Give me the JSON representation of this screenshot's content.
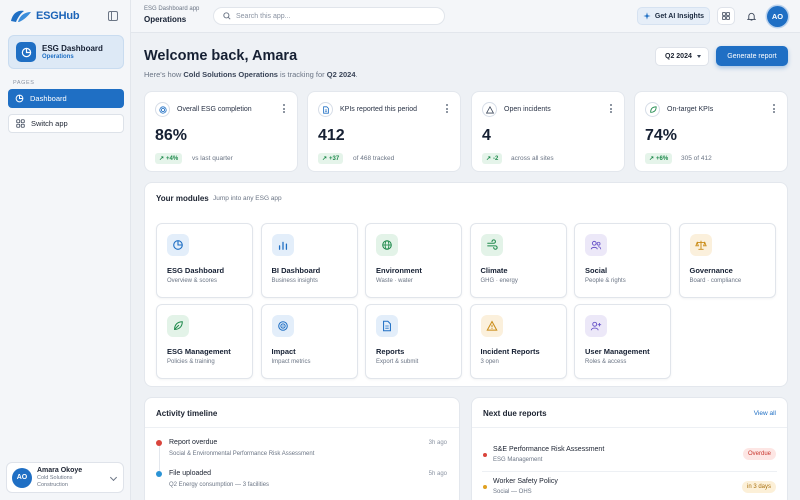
{
  "brand": {
    "name": "ESGHub"
  },
  "sidebar": {
    "app_card": {
      "title": "ESG Dashboard",
      "subtitle": "Operations"
    },
    "section_label": "PAGES",
    "items": [
      {
        "label": "Dashboard",
        "active": true,
        "icon": "pie-chart-icon"
      },
      {
        "label": "Switch app",
        "active": false,
        "icon": "grid-icon"
      }
    ],
    "user": {
      "initials": "AO",
      "name": "Amara Okoye",
      "org": "Cold Solutions Construction"
    }
  },
  "header": {
    "app_path": "ESG Dashboard app",
    "title": "Operations",
    "search_placeholder": "Search this app...",
    "ai_button": "Get AI Insights",
    "user_initials": "AO"
  },
  "main": {
    "welcome": "Welcome back, Amara",
    "subline": {
      "prefix": "Here's how ",
      "org": "Cold Solutions Operations",
      "middle": " is tracking for ",
      "period": "Q2 2024",
      "suffix": "."
    },
    "quarter_select": "Q2 2024",
    "generate_button": "Generate report",
    "kpis": [
      {
        "label": "Overall ESG completion",
        "value": "86%",
        "delta": "+4%",
        "note": "vs last quarter",
        "icon": "target-icon"
      },
      {
        "label": "KPIs reported this period",
        "value": "412",
        "delta": "+37",
        "note": "of 468 tracked",
        "icon": "document-icon"
      },
      {
        "label": "Open incidents",
        "value": "4",
        "delta": "-2",
        "note": "across all sites",
        "icon": "warning-icon"
      },
      {
        "label": "On-target KPIs",
        "value": "74%",
        "delta": "+6%",
        "note": "305 of 412",
        "icon": "leaf-icon"
      }
    ],
    "modules": {
      "title": "Your modules",
      "subtitle": "Jump into any ESG app",
      "items": [
        {
          "name": "ESG Dashboard",
          "desc": "Overview & scores",
          "icon": "pie-chart-icon",
          "color": "#1f6fc4",
          "bg": "#e3eefa"
        },
        {
          "name": "BI Dashboard",
          "desc": "Business insights",
          "icon": "bar-chart-icon",
          "color": "#1f6fc4",
          "bg": "#e3eefa"
        },
        {
          "name": "Environment",
          "desc": "Waste · water",
          "icon": "globe-icon",
          "color": "#1f8a4c",
          "bg": "#e3f3e8"
        },
        {
          "name": "Climate",
          "desc": "GHG · energy",
          "icon": "wind-icon",
          "color": "#1f8a4c",
          "bg": "#e3f3e8"
        },
        {
          "name": "Social",
          "desc": "People & rights",
          "icon": "people-icon",
          "color": "#6a55c9",
          "bg": "#ece8f8"
        },
        {
          "name": "Governance",
          "desc": "Board · compliance",
          "icon": "scales-icon",
          "color": "#c98a14",
          "bg": "#fbf0dc"
        },
        {
          "name": "ESG Management",
          "desc": "Policies & training",
          "icon": "leaf-icon",
          "color": "#1f8a4c",
          "bg": "#e3f3e8"
        },
        {
          "name": "Impact",
          "desc": "Impact metrics",
          "icon": "target-icon",
          "color": "#1f6fc4",
          "bg": "#e3eefa"
        },
        {
          "name": "Reports",
          "desc": "Export & submit",
          "icon": "document-icon",
          "color": "#1f6fc4",
          "bg": "#e3eefa"
        },
        {
          "name": "Incident Reports",
          "desc": "3 open",
          "icon": "warning-icon",
          "color": "#c98a14",
          "bg": "#fbf0dc"
        },
        {
          "name": "User Management",
          "desc": "Roles & access",
          "icon": "user-plus-icon",
          "color": "#6a55c9",
          "bg": "#ece8f8"
        }
      ]
    },
    "activity": {
      "title": "Activity timeline",
      "items": [
        {
          "title": "Report overdue",
          "desc": "Social & Environmental Performance Risk Assessment",
          "time": "3h ago",
          "color": "#d9443c"
        },
        {
          "title": "File uploaded",
          "desc": "Q2 Energy consumption — 3 facilities",
          "time": "5h ago",
          "color": "#2a93d5"
        }
      ]
    },
    "due_reports": {
      "title": "Next due reports",
      "view_all": "View all",
      "items": [
        {
          "title": "S&E Performance Risk Assessment",
          "sub": "ESG Management",
          "badge": "Overdue",
          "dot": "#d9443c",
          "badge_bg": "#fde6e4",
          "badge_fg": "#c8372f"
        },
        {
          "title": "Worker Safety Policy",
          "sub": "Social — OHS",
          "badge": "in 3 days",
          "dot": "#e0a021",
          "badge_bg": "#fcf0d8",
          "badge_fg": "#a8700f"
        }
      ]
    }
  }
}
